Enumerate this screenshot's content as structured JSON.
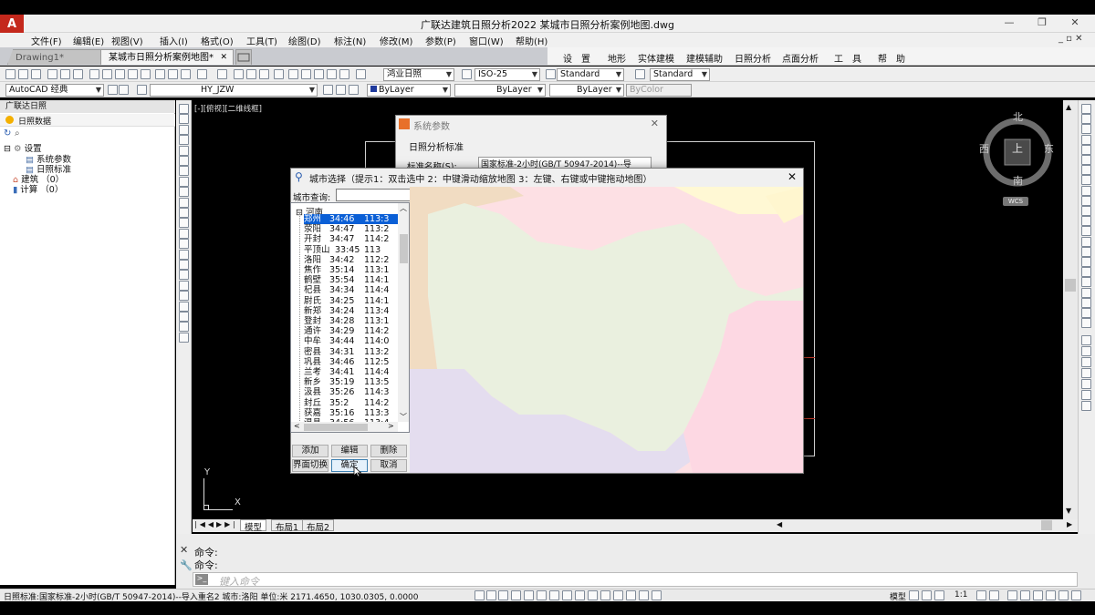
{
  "app": {
    "logo": "A",
    "title": "广联达建筑日照分析2022    某城市日照分析案例地图.dwg",
    "win_min": "—",
    "win_max": "❐",
    "win_close": "✕"
  },
  "menu": {
    "items": [
      "文件(F)",
      "编辑(E)",
      "视图(V)",
      "插入(I)",
      "格式(O)",
      "工具(T)",
      "绘图(D)",
      "标注(N)",
      "修改(M)",
      "参数(P)",
      "窗口(W)",
      "帮助(H)"
    ],
    "right_controls": "_ ▫ ✕"
  },
  "tabs": {
    "inactive": "Drawing1*",
    "active": "某城市日照分析案例地图*",
    "active_close": "✕"
  },
  "custom_menu": {
    "items": [
      "设　置",
      "地形",
      "实体建模",
      "建模辅助",
      "日照分析",
      "点面分析",
      "工　具",
      "帮　助"
    ]
  },
  "toolbar": {
    "style_combo": "鸿业日照",
    "dim_combo": "ISO-25",
    "text_style": "Standard",
    "table_style": "Standard",
    "workspace": "AutoCAD 经典",
    "layer": "HY_JZW",
    "color": "ByLayer",
    "linetype": "ByLayer",
    "lineweight": "ByLayer",
    "plotstyle": "ByColor"
  },
  "left_panel": {
    "title": "广联达日照",
    "tab": "日照数据",
    "tree": {
      "settings": "设置",
      "system_params": "系统参数",
      "sun_standard": "日照标准",
      "buildings": "建筑 （0）",
      "calculations": "计算 （0）"
    }
  },
  "canvas": {
    "viewport_label": "[-][俯视][二维线框]",
    "compass_n": "北",
    "compass_s": "南",
    "compass_e": "东",
    "compass_w": "西",
    "compass_center": "上",
    "wcs": "WCS",
    "axis_x": "X",
    "axis_y": "Y"
  },
  "layout_tabs": [
    "模型",
    "布局1",
    "布局2"
  ],
  "command": {
    "line1": "命令:",
    "line2": "命令:",
    "placeholder": "键入命令"
  },
  "status": {
    "text": "日照标准:国家标准-2小时(GB/T 50947-2014)--导入重名2  城市:洛阳  单位:米   2171.4650, 1030.0305, 0.0000",
    "model": "模型",
    "scale": "1:1"
  },
  "sys_dialog": {
    "title": "系统参数",
    "section": "日照分析标准",
    "field_label": "标准名称(S):",
    "field_value": "国家标准-2小时(GB/T 50947-2014)--导"
  },
  "city_dialog": {
    "title": "城市选择（提示1：双击选中  2：中键滑动缩放地图  3：左键、右键或中键拖动地图）",
    "query_label": "城市查询:",
    "query_value": "",
    "province": "河南",
    "cities": [
      {
        "name": "郑州",
        "lat": "34:46",
        "lon": "113:3",
        "selected": true
      },
      {
        "name": "荥阳",
        "lat": "34:47",
        "lon": "113:2",
        "selected": false
      },
      {
        "name": "开封",
        "lat": "34:47",
        "lon": "114:2",
        "selected": false
      },
      {
        "name": "平顶山",
        "lat": "33:45",
        "lon": "113",
        "selected": false
      },
      {
        "name": "洛阳",
        "lat": "34:42",
        "lon": "112:2",
        "selected": false
      },
      {
        "name": "焦作",
        "lat": "35:14",
        "lon": "113:1",
        "selected": false
      },
      {
        "name": "鹤壁",
        "lat": "35:54",
        "lon": "114:1",
        "selected": false
      },
      {
        "name": "杞县",
        "lat": "34:34",
        "lon": "114:4",
        "selected": false
      },
      {
        "name": "尉氏",
        "lat": "34:25",
        "lon": "114:1",
        "selected": false
      },
      {
        "name": "新郑",
        "lat": "34:24",
        "lon": "113:4",
        "selected": false
      },
      {
        "name": "登封",
        "lat": "34:28",
        "lon": "113:1",
        "selected": false
      },
      {
        "name": "通许",
        "lat": "34:29",
        "lon": "114:2",
        "selected": false
      },
      {
        "name": "中牟",
        "lat": "34:44",
        "lon": "114:0",
        "selected": false
      },
      {
        "name": "密县",
        "lat": "34:31",
        "lon": "113:2",
        "selected": false
      },
      {
        "name": "巩县",
        "lat": "34:46",
        "lon": "112:5",
        "selected": false
      },
      {
        "name": "兰考",
        "lat": "34:41",
        "lon": "114:4",
        "selected": false
      },
      {
        "name": "新乡",
        "lat": "35:19",
        "lon": "113:5",
        "selected": false
      },
      {
        "name": "汲县",
        "lat": "35:26",
        "lon": "114:3",
        "selected": false
      },
      {
        "name": "封丘",
        "lat": "35:2",
        "lon": "114:2",
        "selected": false
      },
      {
        "name": "获嘉",
        "lat": "35:16",
        "lon": "113:3",
        "selected": false
      },
      {
        "name": "温县",
        "lat": "34:56",
        "lon": "113:4",
        "selected": false
      }
    ],
    "buttons": {
      "add": "添加",
      "edit": "编辑",
      "delete": "删除",
      "switch": "界面切换",
      "ok": "确定",
      "cancel": "取消"
    },
    "close": "✕"
  }
}
